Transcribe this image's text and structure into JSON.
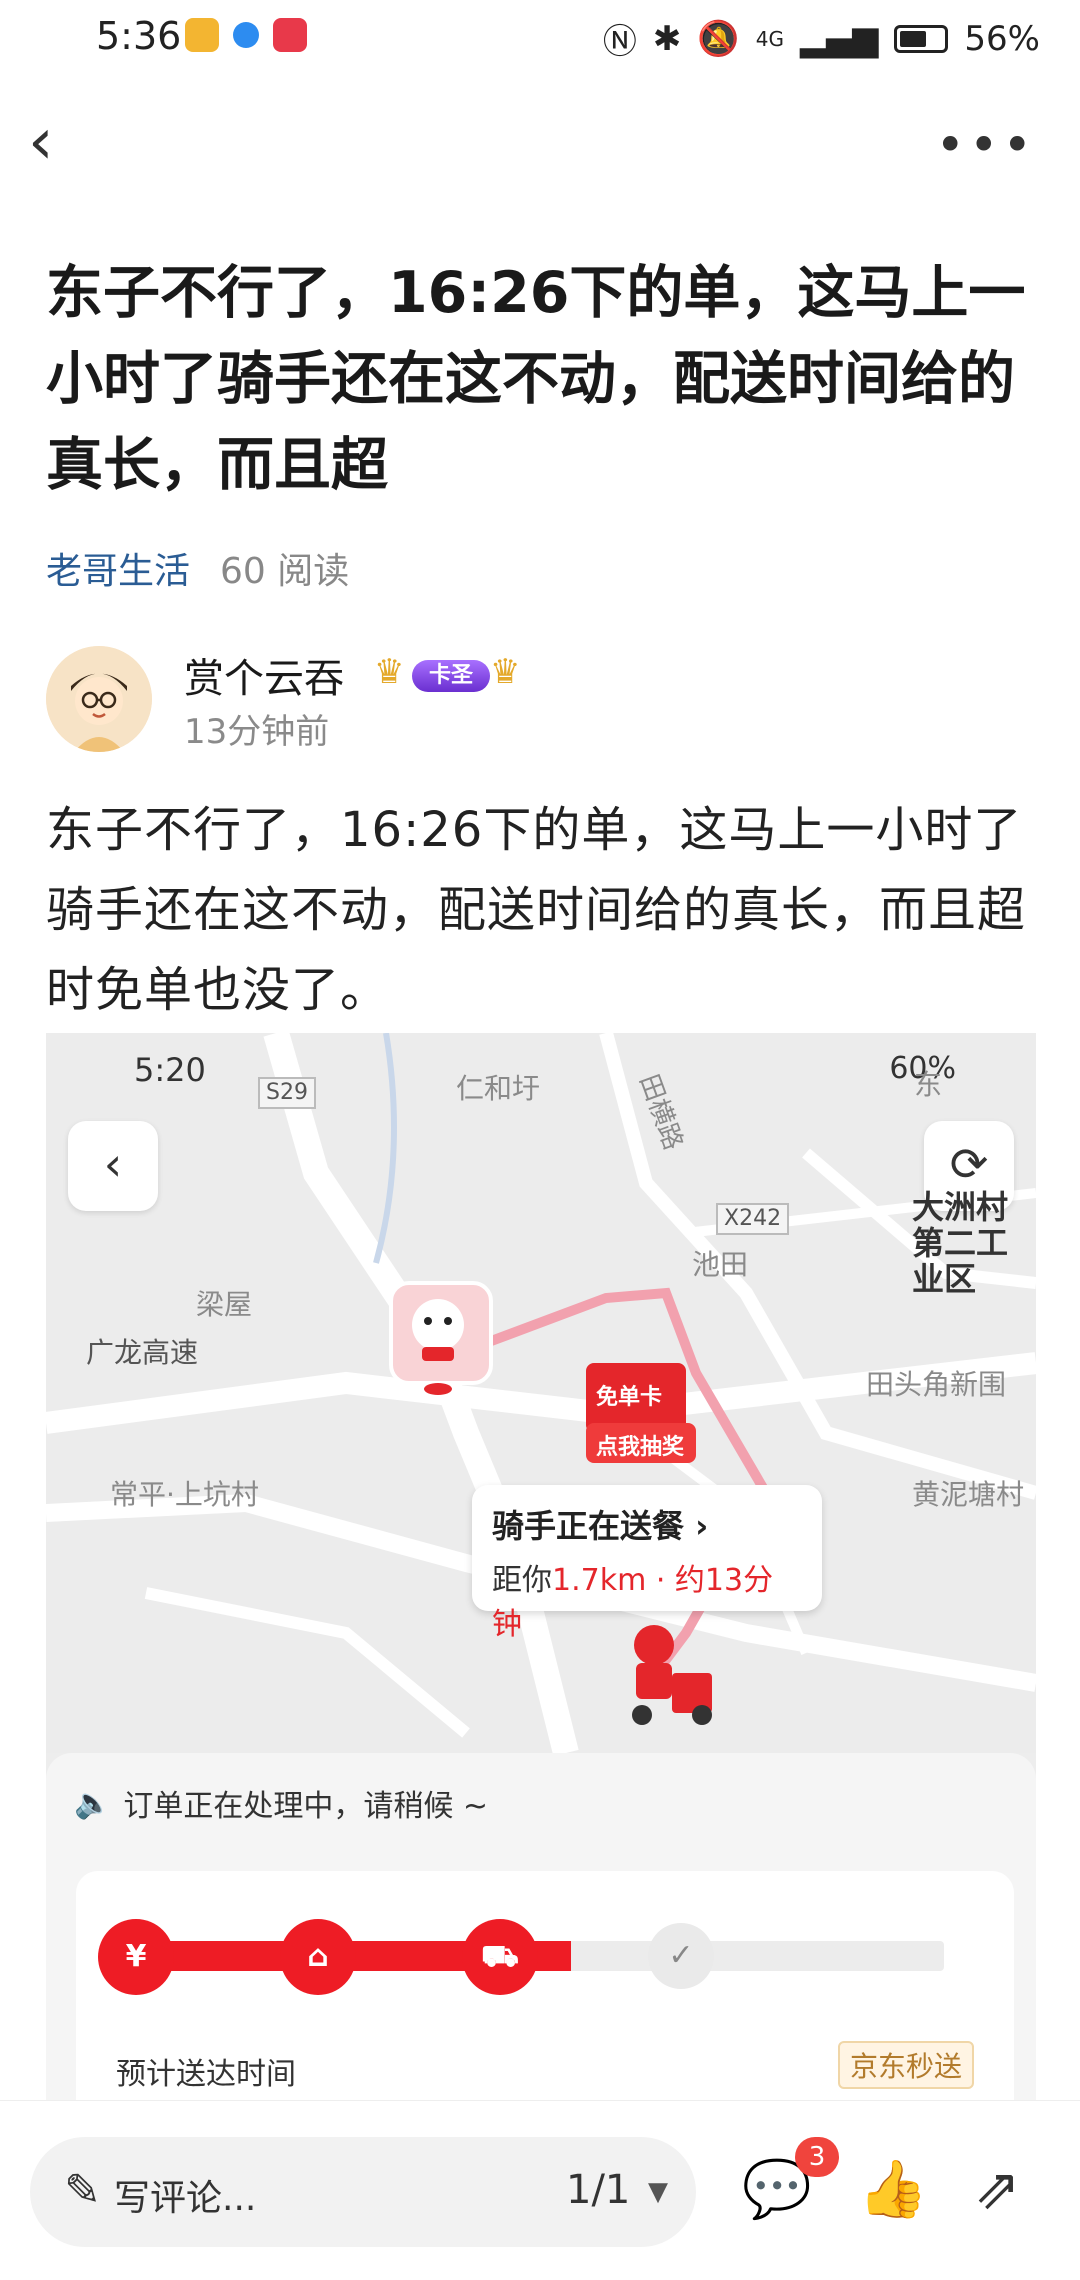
{
  "status_bar": {
    "time": "5:36",
    "network": "4G",
    "battery": "56%"
  },
  "post": {
    "title": "东子不行了，16:26下的单，这马上一小时了骑手还在这不动，配送时间给的真长，而且超",
    "channel": "老哥生活",
    "reads": "60 阅读",
    "author": {
      "name": "赏个云吞",
      "badge": "卡圣",
      "time": "13分钟前"
    },
    "body": "东子不行了，16:26下的单，这马上一小时了骑手还在这不动，配送时间给的真长，而且超时免单也没了。"
  },
  "embedded_screenshot": {
    "status": {
      "time": "5:20",
      "battery": "60%"
    },
    "map_labels": {
      "renhexu": "仁和圩",
      "tianhenglu": "田横路",
      "road_s29": "S29",
      "road_x242": "X242",
      "dazhou": "大洲村第二工业区",
      "chitian": "池田",
      "liangwu": "梁屋",
      "guanglong": "广龙高速",
      "tiantoujiao": "田头角新围",
      "changping": "常平·上坑村",
      "huangnitang": "黄泥塘村",
      "dong": "东"
    },
    "coupon": {
      "line1": "免单卡",
      "line2": "点我抽奖"
    },
    "rider_status": {
      "title": "骑手正在送餐",
      "prefix": "距你",
      "distance": "1.7km · 约13分钟"
    },
    "notice": "订单正在处理中，请稍候 ~",
    "progress": {
      "fraction": 0.55,
      "eta_label": "预计送达时间",
      "service_tag": "京东秒送"
    }
  },
  "bottom_bar": {
    "comment_placeholder": "写评论...",
    "page": "1/1",
    "comment_count": "3"
  },
  "colors": {
    "jd_red": "#ee1c25",
    "link_blue": "#2a5c94"
  }
}
